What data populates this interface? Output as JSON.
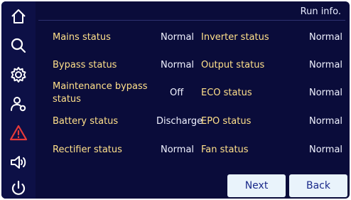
{
  "header": {
    "title": "Run info."
  },
  "sidebar": {
    "icons": [
      "home-icon",
      "search-icon",
      "settings-icon",
      "user-icon",
      "alarm-icon",
      "speaker-icon",
      "power-icon"
    ],
    "alarm_color": "#e53a3a",
    "icon_color": "#ffffff"
  },
  "left_column": [
    {
      "label": "Mains status",
      "value": "Normal"
    },
    {
      "label": "Bypass status",
      "value": "Normal"
    },
    {
      "label": "Maintenance bypass status",
      "value": "Off"
    },
    {
      "label": "Battery status",
      "value": "Discharge"
    },
    {
      "label": "Rectifier status",
      "value": "Normal"
    }
  ],
  "right_column": [
    {
      "label": "Inverter status",
      "value": "Normal"
    },
    {
      "label": "Output status",
      "value": "Normal"
    },
    {
      "label": "ECO status",
      "value": "Normal"
    },
    {
      "label": "EPO status",
      "value": "Normal"
    },
    {
      "label": "Fan status",
      "value": "Normal"
    }
  ],
  "buttons": {
    "next": "Next",
    "back": "Back"
  }
}
